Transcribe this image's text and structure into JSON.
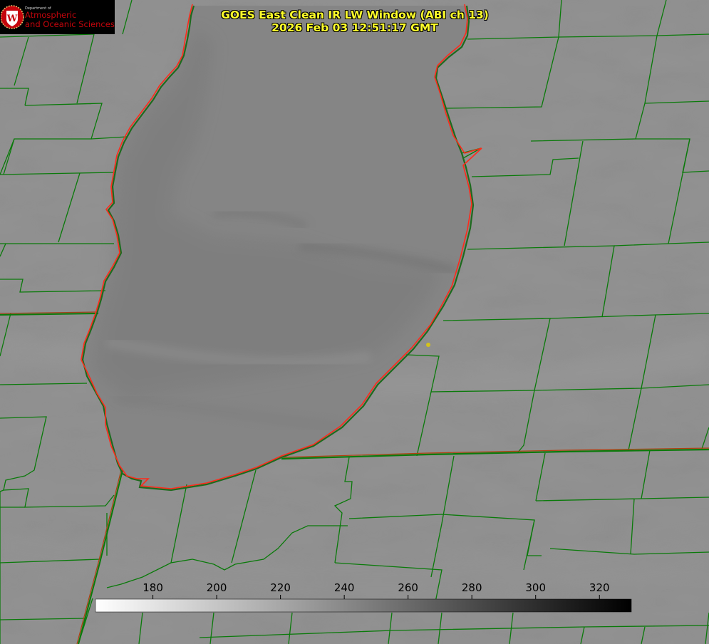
{
  "header": {
    "title_line1": "GOES East Clean IR LW Window (ABI ch 13)",
    "title_line2": "2026 Feb 03 12:51:17 GMT"
  },
  "logo": {
    "line1": "Department of",
    "line2": "Atmospheric",
    "line3": "and Oceanic Sciences",
    "emblem_letter": "W"
  },
  "colorbar": {
    "ticks": [
      {
        "value": 180,
        "label": "180"
      },
      {
        "value": 200,
        "label": "200"
      },
      {
        "value": 220,
        "label": "220"
      },
      {
        "value": 240,
        "label": "240"
      },
      {
        "value": 260,
        "label": "260"
      },
      {
        "value": 280,
        "label": "280"
      },
      {
        "value": 300,
        "label": "300"
      },
      {
        "value": 320,
        "label": "320"
      }
    ],
    "range": [
      162,
      330
    ],
    "gradient": "white-to-black"
  },
  "colors": {
    "county_lines": "#0a7a0a",
    "coastline": "#ff2a1a",
    "title_text": "#ffff2a",
    "logo_red": "#c5050c",
    "marker": "#d4c21a",
    "background_gray": "#8c8c8c",
    "lake_gray": "#858585"
  },
  "map": {
    "feature": "lake outline with county boundaries",
    "marker_icon": "location-dot-icon"
  }
}
